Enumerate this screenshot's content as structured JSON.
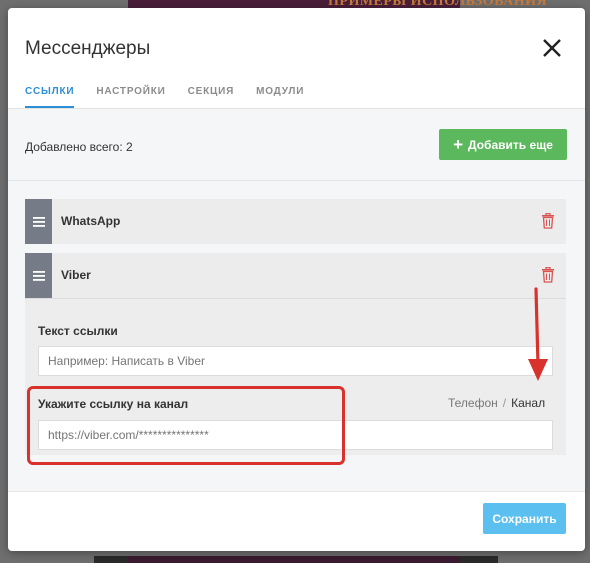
{
  "background": {
    "banner_text": "ПРИМЕРЫ ИСПОЛЬЗОВАНИЯ"
  },
  "modal": {
    "title": "Мессенджеры",
    "close_icon": "close-icon",
    "tabs": [
      {
        "label": "ССЫЛКИ",
        "active": true
      },
      {
        "label": "НАСТРОЙКИ",
        "active": false
      },
      {
        "label": "СЕКЦИЯ",
        "active": false
      },
      {
        "label": "МОДУЛИ",
        "active": false
      }
    ],
    "added_total": "Добавлено всего: 2",
    "add_button": "Добавить еще",
    "items": [
      {
        "name": "WhatsApp",
        "expanded": false
      },
      {
        "name": "Viber",
        "expanded": true
      }
    ],
    "link_text_label": "Текст ссылки",
    "link_text_placeholder": "Например: Написать в Viber",
    "channel_label": "Укажите ссылку на канал",
    "channel_placeholder": "https://viber.com/***************",
    "switch": {
      "option1": "Телефон",
      "separator": "/",
      "option2": "Канал",
      "selected": "Канал"
    },
    "save_button": "Сохранить"
  },
  "colors": {
    "accent_blue": "#2e8fd6",
    "add_green": "#5cb85c",
    "save_blue": "#5bc0f0",
    "delete_red": "#d9534f",
    "annotation_red": "#d9322c"
  }
}
